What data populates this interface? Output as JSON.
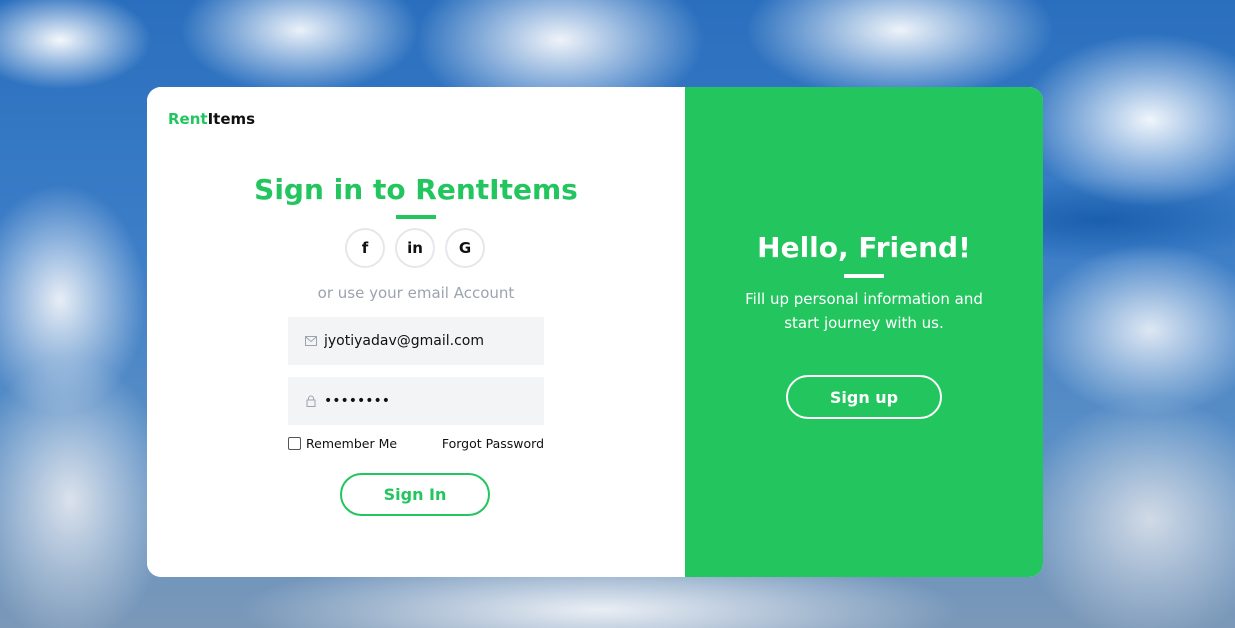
{
  "brand": {
    "part1": "Rent",
    "part2": "Items"
  },
  "signin": {
    "title": "Sign in to RentItems",
    "social": [
      {
        "label": "f",
        "icon": "facebook-icon"
      },
      {
        "label": "in",
        "icon": "linkedin-icon"
      },
      {
        "label": "G",
        "icon": "google-icon"
      }
    ],
    "or_text": "or use your email Account",
    "email_value": "jyotiyadav@gmail.com",
    "password_value": "••••••••",
    "remember_label": "Remember Me",
    "forgot_label": "Forgot Password",
    "signin_label": "Sign In"
  },
  "panel": {
    "title": "Hello, Friend!",
    "text": "Fill up personal information and start journey with us.",
    "signup_label": "Sign up"
  },
  "colors": {
    "accent": "#22c55e",
    "field_bg": "#f3f4f6",
    "muted": "#9ca3af"
  }
}
